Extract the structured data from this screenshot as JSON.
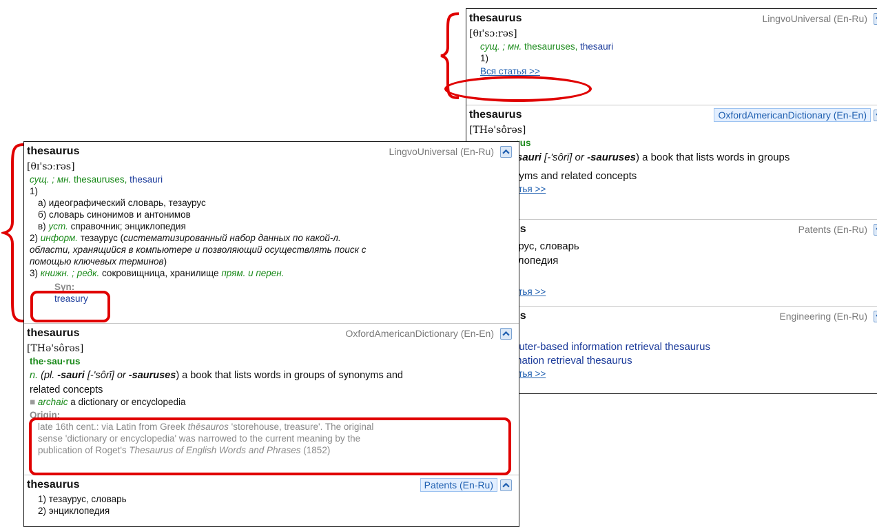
{
  "back": {
    "e1": {
      "headword": "thesaurus",
      "dict": "LingvoUniversal (En-Ru)",
      "transcription": "[θɪ'sɔːrəs]",
      "gram": "сущ. ; мн.",
      "form1": "thesauruses,",
      "form2": "thesauri",
      "n1": "1)",
      "more": "Вся статья >>"
    },
    "e2": {
      "headword": "thesaurus",
      "dict": "OxfordAmericanDictionary (En-En)",
      "transcription": "[THə'sôrəs]",
      "syll_tail": "·rus",
      "def_a": "-sauri",
      "def_b": " [-'sôrī]",
      "def_c": " or ",
      "def_d": "-sauruses",
      "def_e": ") a book that lists words in groups",
      "def2": "nyms and related concepts",
      "more": "атья >>"
    },
    "e3": {
      "headword": "us",
      "dict": "Patents (En-Ru)",
      "l1": "урус, словарь",
      "l2": "клопедия",
      "more": "атья >>"
    },
    "e4": {
      "headword": "us",
      "dict": "Engineering (En-Ru)",
      "l1": "puter-based information retrieval thesaurus",
      "l2": "mation retrieval thesaurus",
      "more": "атья >>"
    }
  },
  "front": {
    "e1": {
      "headword": "thesaurus",
      "dict": "LingvoUniversal (En-Ru)",
      "transcription": "[θɪ'sɔːrəs]",
      "gram": "сущ. ; мн.",
      "form1": "thesauruses,",
      "form2": "thesauri",
      "n1": "1)",
      "a": "а) идеографический словарь, тезаурус",
      "b": "б) словарь синонимов и антонимов",
      "c_label": "в)",
      "c_gram": "уст.",
      "c_text": "справочник; энциклопедия",
      "n2": "2)",
      "n2_gram": "информ.",
      "n2_text": "тезаурус (",
      "n2_it1": "систематизированный набор данных по какой-л.",
      "n2_it2": "области, хранящийся в компьютере и позволяющий осуществлять поиск с",
      "n2_it3": "помощью ключевых терминов",
      "n2_close": ")",
      "n3": "3)",
      "n3_gram": "книжн. ; редк.",
      "n3_text": "сокровищница, хранилище",
      "n3_gram2": "прям. и перен.",
      "syn_label": "Syn:",
      "syn_value": "treasury"
    },
    "e2": {
      "headword": "thesaurus",
      "dict": "OxfordAmericanDictionary (En-En)",
      "transcription": "[THə'sôrəs]",
      "syllables": "the·sau·rus",
      "pos": "n.",
      "def_a": " (pl. ",
      "def_b": "-sauri",
      "def_c": " [-'sôrī]",
      "def_d": " or ",
      "def_e": "-sauruses",
      "def_f": ") a book that lists words in groups of synonyms and",
      "def_g": "related concepts",
      "bullet": "■",
      "sub_gram": "archaic",
      "sub_text": "a dictionary or encyclopedia",
      "origin_label": "Origin:",
      "o1": "late 16th cent.: via Latin from Greek ",
      "o1_it": "thēsauros",
      "o1_end": " 'storehouse, treasure'. The original",
      "o2": "sense 'dictionary or encyclopedia' was narrowed to the current meaning by the",
      "o3": "publication of Roget's ",
      "o3_it": "Thesaurus of English Words and Phrases",
      "o3_end": " (1852)"
    },
    "e3": {
      "headword": "thesaurus",
      "dict": "Patents (En-Ru)",
      "l1": "1) тезаурус, словарь",
      "l2": "2) энциклопедия"
    }
  },
  "icons": {
    "expand": "chevron-down-icon",
    "collapse": "chevron-up-icon"
  },
  "colors": {
    "annotation": "#e00000",
    "grammar": "#1a8a1a",
    "word_form": "#1a3a9a",
    "link": "#1f5fb0",
    "highlight_tag_bg": "#e3efff"
  }
}
